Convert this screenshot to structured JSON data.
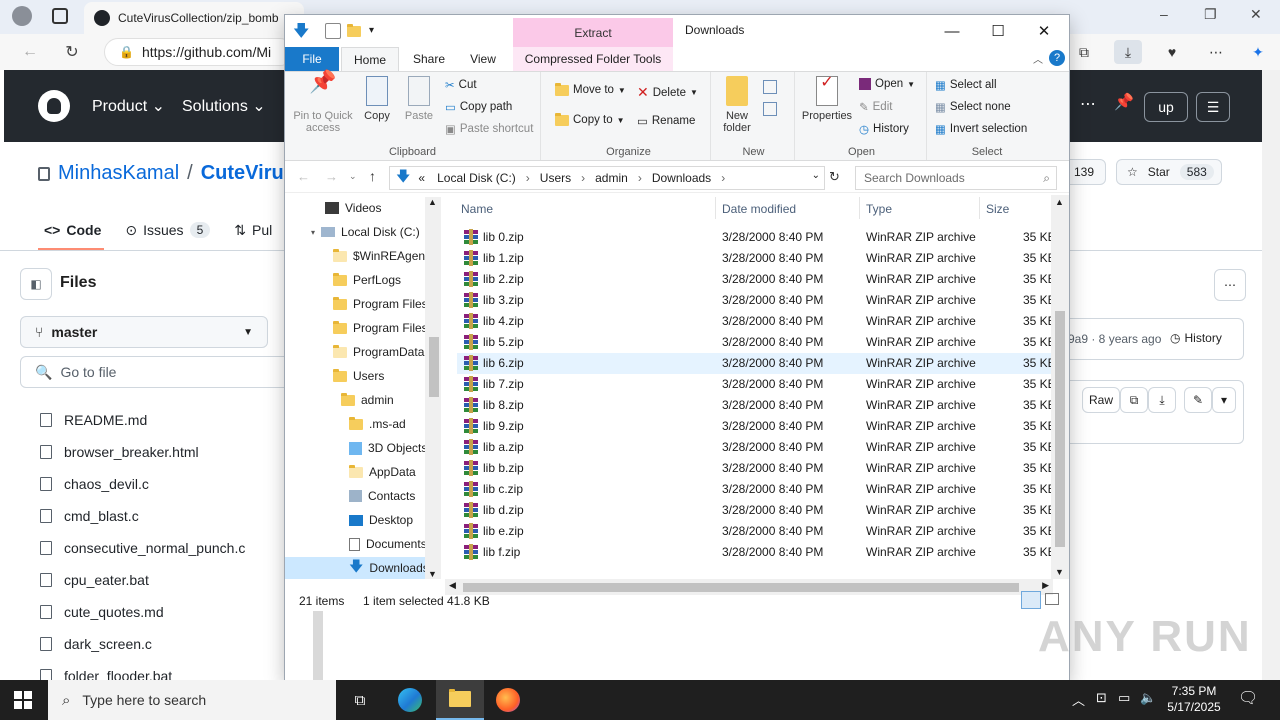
{
  "browser": {
    "tab_title": "CuteVirusCollection/zip_bomb",
    "url": "https://github.com/Mi",
    "window_controls": [
      "–",
      "❐",
      "✕"
    ]
  },
  "github": {
    "nav": [
      "Product",
      "Solutions"
    ],
    "signup": "up",
    "repo_owner": "MinhasKamal",
    "repo_sep": "/",
    "repo_name": "CuteVirus",
    "tabs": {
      "code": "Code",
      "issues": "Issues",
      "issues_count": "5",
      "pulls": "Pul"
    },
    "watch_count": "139",
    "star_label": "Star",
    "star_count": "583",
    "commit_info": "9a9 · 8 years ago",
    "history_label": "History",
    "raw_label": "Raw",
    "files_title": "Files",
    "branch": "master",
    "goto_file": "Go to file",
    "files": [
      "README.md",
      "browser_breaker.html",
      "chaos_devil.c",
      "cmd_blast.c",
      "consecutive_normal_punch.c",
      "cpu_eater.bat",
      "cute_quotes.md",
      "dark_screen.c",
      "folder_flooder.bat"
    ]
  },
  "explorer": {
    "title": "Downloads",
    "context_tab_group": "Extract",
    "ribbon_tabs": {
      "file": "File",
      "home": "Home",
      "share": "Share",
      "view": "View",
      "ctx": "Compressed Folder Tools"
    },
    "clipboard": {
      "pin": "Pin to Quick access",
      "copy": "Copy",
      "paste": "Paste",
      "cut": "Cut",
      "copy_path": "Copy path",
      "paste_shortcut": "Paste shortcut",
      "label": "Clipboard"
    },
    "organize": {
      "move_to": "Move to",
      "copy_to": "Copy to",
      "delete": "Delete",
      "rename": "Rename",
      "label": "Organize"
    },
    "new_group": {
      "new_folder": "New folder",
      "label": "New"
    },
    "open_group": {
      "properties": "Properties",
      "open": "Open",
      "edit": "Edit",
      "history": "History",
      "label": "Open"
    },
    "select_group": {
      "select_all": "Select all",
      "select_none": "Select none",
      "invert": "Invert selection",
      "label": "Select"
    },
    "breadcrumbs": [
      "Local Disk (C:)",
      "Users",
      "admin",
      "Downloads"
    ],
    "breadcrumb_prefix": "«",
    "search_placeholder": "Search Downloads",
    "nav_items": [
      "Videos",
      "Local Disk (C:)",
      "$WinREAgent",
      "PerfLogs",
      "Program Files",
      "Program Files",
      "ProgramData",
      "Users",
      "admin",
      ".ms-ad",
      "3D Objects",
      "AppData",
      "Contacts",
      "Desktop",
      "Documents",
      "Downloads"
    ],
    "columns": {
      "name": "Name",
      "date": "Date modified",
      "type": "Type",
      "size": "Size"
    },
    "files": [
      {
        "name": "lib 0.zip",
        "date": "3/28/2000 8:40 PM",
        "type": "WinRAR ZIP archive",
        "size": "35 KB"
      },
      {
        "name": "lib 1.zip",
        "date": "3/28/2000 8:40 PM",
        "type": "WinRAR ZIP archive",
        "size": "35 KB"
      },
      {
        "name": "lib 2.zip",
        "date": "3/28/2000 8:40 PM",
        "type": "WinRAR ZIP archive",
        "size": "35 KB"
      },
      {
        "name": "lib 3.zip",
        "date": "3/28/2000 8:40 PM",
        "type": "WinRAR ZIP archive",
        "size": "35 KB"
      },
      {
        "name": "lib 4.zip",
        "date": "3/28/2000 8:40 PM",
        "type": "WinRAR ZIP archive",
        "size": "35 KB"
      },
      {
        "name": "lib 5.zip",
        "date": "3/28/2000 8:40 PM",
        "type": "WinRAR ZIP archive",
        "size": "35 KB"
      },
      {
        "name": "lib 6.zip",
        "date": "3/28/2000 8:40 PM",
        "type": "WinRAR ZIP archive",
        "size": "35 KB"
      },
      {
        "name": "lib 7.zip",
        "date": "3/28/2000 8:40 PM",
        "type": "WinRAR ZIP archive",
        "size": "35 KB"
      },
      {
        "name": "lib 8.zip",
        "date": "3/28/2000 8:40 PM",
        "type": "WinRAR ZIP archive",
        "size": "35 KB"
      },
      {
        "name": "lib 9.zip",
        "date": "3/28/2000 8:40 PM",
        "type": "WinRAR ZIP archive",
        "size": "35 KB"
      },
      {
        "name": "lib a.zip",
        "date": "3/28/2000 8:40 PM",
        "type": "WinRAR ZIP archive",
        "size": "35 KB"
      },
      {
        "name": "lib b.zip",
        "date": "3/28/2000 8:40 PM",
        "type": "WinRAR ZIP archive",
        "size": "35 KB"
      },
      {
        "name": "lib c.zip",
        "date": "3/28/2000 8:40 PM",
        "type": "WinRAR ZIP archive",
        "size": "35 KB"
      },
      {
        "name": "lib d.zip",
        "date": "3/28/2000 8:40 PM",
        "type": "WinRAR ZIP archive",
        "size": "35 KB"
      },
      {
        "name": "lib e.zip",
        "date": "3/28/2000 8:40 PM",
        "type": "WinRAR ZIP archive",
        "size": "35 KB"
      },
      {
        "name": "lib f.zip",
        "date": "3/28/2000 8:40 PM",
        "type": "WinRAR ZIP archive",
        "size": "35 KB"
      }
    ],
    "selected_index": 6,
    "status": {
      "count": "21 items",
      "selected": "1 item selected",
      "size": "41.8 KB"
    }
  },
  "taskbar": {
    "search_placeholder": "Type here to search",
    "time": "7:35 PM",
    "date": "5/17/2025"
  },
  "watermark": "ANY RUN",
  "colors": {
    "accent": "#1979ca",
    "ctx_tab": "#fbc9e8",
    "gh_header": "#24292f",
    "selection": "#e5f3ff"
  }
}
